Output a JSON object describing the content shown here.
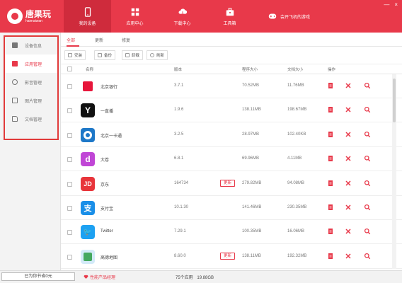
{
  "app": {
    "title": "唐果玩",
    "subtitle": "haimaiwan"
  },
  "nav": {
    "items": [
      {
        "label": "我的设备",
        "icon": "phone-icon"
      },
      {
        "label": "应用中心",
        "icon": "grid-icon"
      },
      {
        "label": "下载中心",
        "icon": "cloud-download-icon"
      },
      {
        "label": "工具箱",
        "icon": "toolbox-icon"
      },
      {
        "label": "会开飞机的游戏",
        "icon": "controller-icon"
      }
    ]
  },
  "window_controls": {
    "minimize": "—",
    "close": "×"
  },
  "sidebar": {
    "items": [
      {
        "label": "设备信息",
        "icon": "monitor-icon"
      },
      {
        "label": "应用管理",
        "icon": "apps-icon"
      },
      {
        "label": "影音管理",
        "icon": "music-icon"
      },
      {
        "label": "图片管理",
        "icon": "image-icon"
      },
      {
        "label": "文档管理",
        "icon": "document-icon"
      }
    ]
  },
  "tabs": [
    {
      "label": "全部"
    },
    {
      "label": "更新"
    },
    {
      "label": "修复"
    }
  ],
  "toolbar": {
    "buttons": [
      {
        "label": "安装",
        "icon": "install-icon"
      },
      {
        "label": "备份",
        "icon": "backup-icon"
      },
      {
        "label": "卸载",
        "icon": "uninstall-icon"
      },
      {
        "label": "刷新",
        "icon": "refresh-icon"
      }
    ]
  },
  "table": {
    "headers": [
      "名称",
      "版本",
      "程序大小",
      "文档大小",
      "操作"
    ],
    "rows": [
      {
        "name": "北京银行",
        "version": "3.7.1",
        "program_size": "70.52MB",
        "doc_size": "11.76MB",
        "icon": "bank-app-icon",
        "icon_color": "#ffffff",
        "update": ""
      },
      {
        "name": "一直播",
        "version": "1.9.6",
        "program_size": "138.11MB",
        "doc_size": "198.67MB",
        "icon": "live-app-icon",
        "icon_color": "#111111",
        "update": ""
      },
      {
        "name": "北京一卡通",
        "version": "3.2.5",
        "program_size": "28.97MB",
        "doc_size": "102.40KB",
        "icon": "card-app-icon",
        "icon_color": "#1e78c8",
        "update": ""
      },
      {
        "name": "大卷",
        "version": "6.8.1",
        "program_size": "69.96MB",
        "doc_size": "4.11MB",
        "icon": "video-app-icon",
        "icon_color": "#c046d6",
        "update": ""
      },
      {
        "name": "京东",
        "version": "164734",
        "program_size": "279.82MB",
        "doc_size": "94.08MB",
        "icon": "jd-app-icon",
        "icon_color": "#e8353b",
        "update": "更新"
      },
      {
        "name": "支付宝",
        "version": "10.1.30",
        "program_size": "141.46MB",
        "doc_size": "230.35MB",
        "icon": "alipay-app-icon",
        "icon_color": "#1a8fe8",
        "update": ""
      },
      {
        "name": "Twitter",
        "version": "7.29.1",
        "program_size": "100.35MB",
        "doc_size": "16.06MB",
        "icon": "twitter-app-icon",
        "icon_color": "#1da1f2",
        "update": ""
      },
      {
        "name": "高德地图",
        "version": "8.60.0",
        "program_size": "138.11MB",
        "doc_size": "192.32MB",
        "icon": "map-app-icon",
        "icon_color": "#d3eaf8",
        "update": "更新"
      }
    ]
  },
  "footer": {
    "saved": "已为你节省0元",
    "feedback": "性能产品经理",
    "summary_count": "75个应用",
    "summary_size": "19.88GB"
  },
  "colors": {
    "brand": "#e8394a",
    "brand_dark": "#cf2b3c",
    "highlight": "#e13a3a"
  }
}
